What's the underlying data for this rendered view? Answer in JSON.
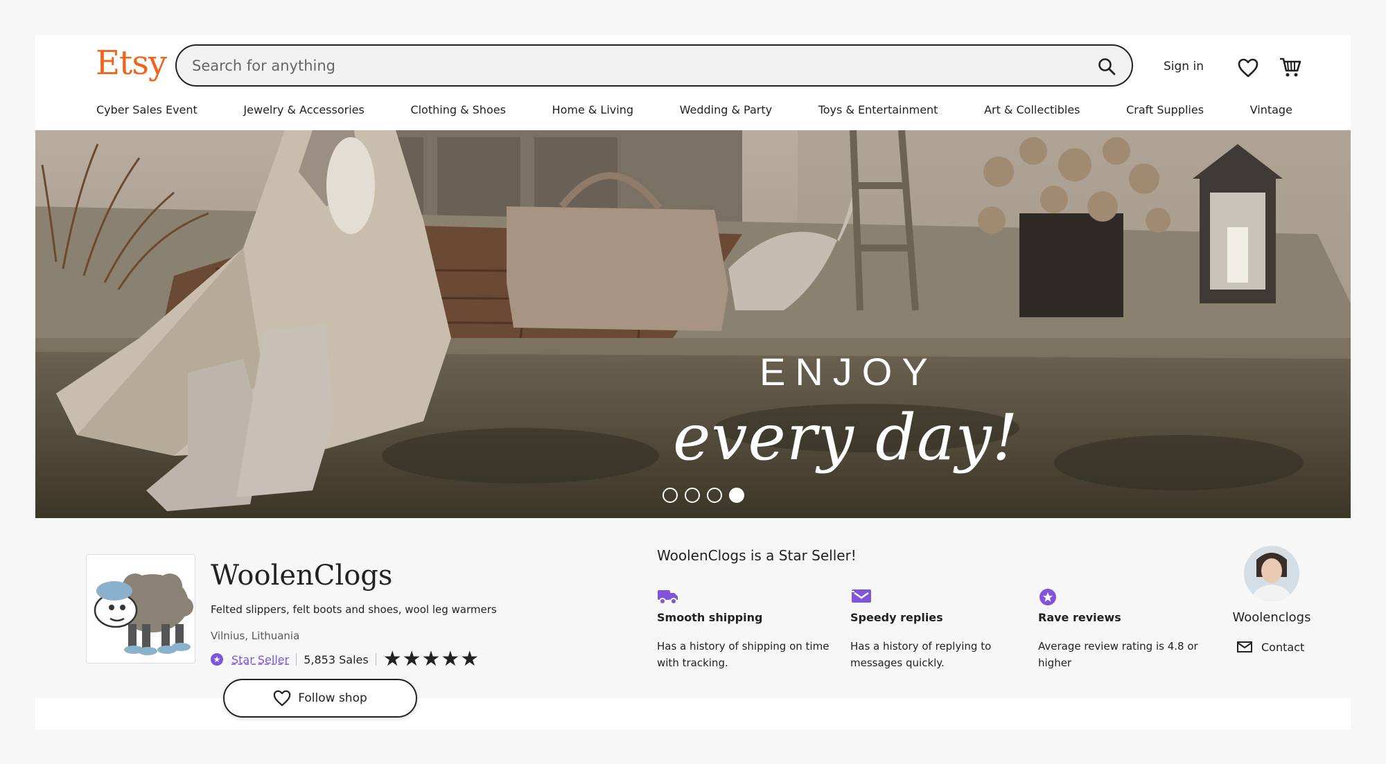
{
  "header": {
    "logo": "Etsy",
    "search_placeholder": "Search for anything",
    "sign_in": "Sign in"
  },
  "nav": {
    "items": [
      "Cyber Sales Event",
      "Jewelry & Accessories",
      "Clothing & Shoes",
      "Home & Living",
      "Wedding & Party",
      "Toys & Entertainment",
      "Art & Collectibles",
      "Craft Supplies",
      "Vintage"
    ]
  },
  "hero": {
    "line1": "ENJOY",
    "line2": "every day!",
    "slides": 4,
    "active_slide": 4
  },
  "shop": {
    "name": "WoolenClogs",
    "description": "Felted slippers, felt boots and shoes, wool leg warmers",
    "location": "Vilnius, Lithuania",
    "star_seller_label": "Star Seller",
    "sales": "5,853 Sales",
    "rating_stars": 5,
    "follow_label": "Follow shop"
  },
  "star_seller": {
    "title": "WoolenClogs is a Star Seller!",
    "features": [
      {
        "icon": "truck-icon",
        "title": "Smooth shipping",
        "desc": "Has a history of shipping on time with tracking."
      },
      {
        "icon": "message-icon",
        "title": "Speedy replies",
        "desc": "Has a history of replying to messages quickly."
      },
      {
        "icon": "star-badge-icon",
        "title": "Rave reviews",
        "desc": "Average review rating is 4.8 or higher"
      }
    ]
  },
  "owner": {
    "name": "Woolenclogs",
    "contact_label": "Contact"
  },
  "colors": {
    "brand": "#f1641e",
    "star_seller": "#7f56d9",
    "page_bg": "#f7f7f7"
  }
}
